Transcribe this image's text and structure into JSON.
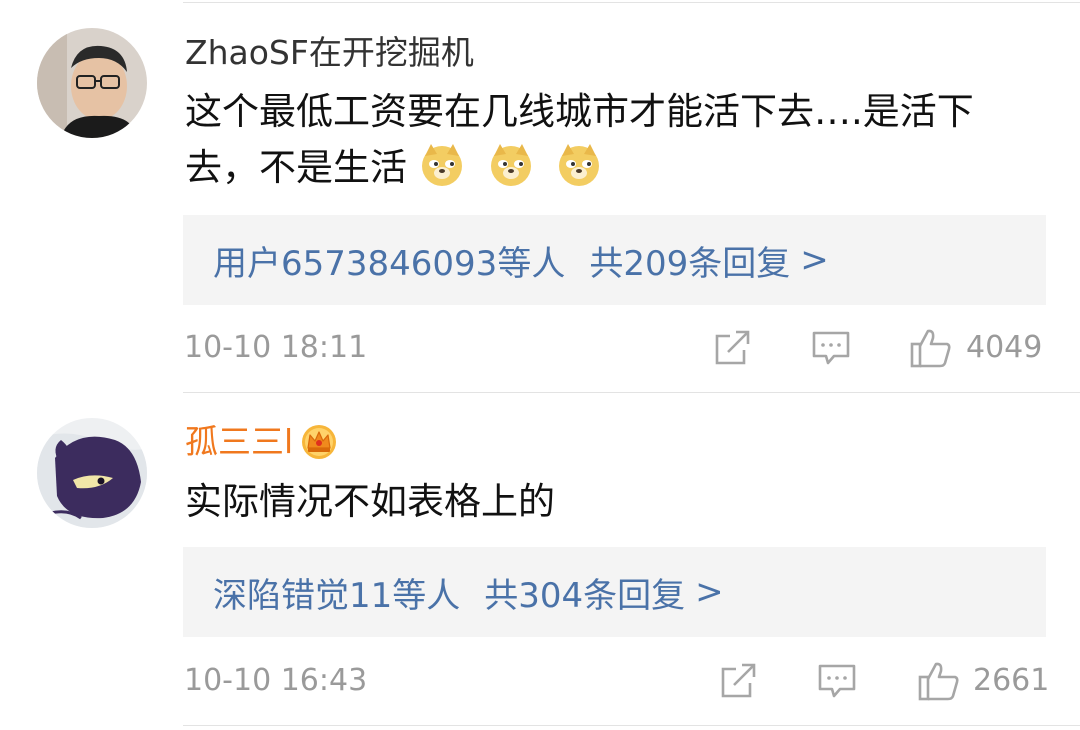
{
  "comments": [
    {
      "username": "ZhaoSF在开挖掘机",
      "text": "这个最低工资要在几线城市才能活下去….是活下去，不是生活",
      "emoji": [
        "doge-emoji",
        "doge-emoji",
        "doge-emoji"
      ],
      "reply_users": "用户6573846093等人",
      "reply_count": "共209条回复",
      "reply_arrow": ">",
      "time": "10-10 18:11",
      "likes": "4049"
    },
    {
      "username": "孤三三l",
      "badge_icon": "crown-icon",
      "text": "实际情况不如表格上的",
      "reply_users": "深陷错觉11等人",
      "reply_count": "共304条回复",
      "reply_arrow": ">",
      "time": "10-10 16:43",
      "likes": "2661"
    }
  ],
  "colors": {
    "username": "#333333",
    "vip_username": "#f0781e",
    "link_blue": "#4a72a8",
    "meta_gray": "#9a9a9a",
    "reply_bg": "#f4f4f4"
  }
}
